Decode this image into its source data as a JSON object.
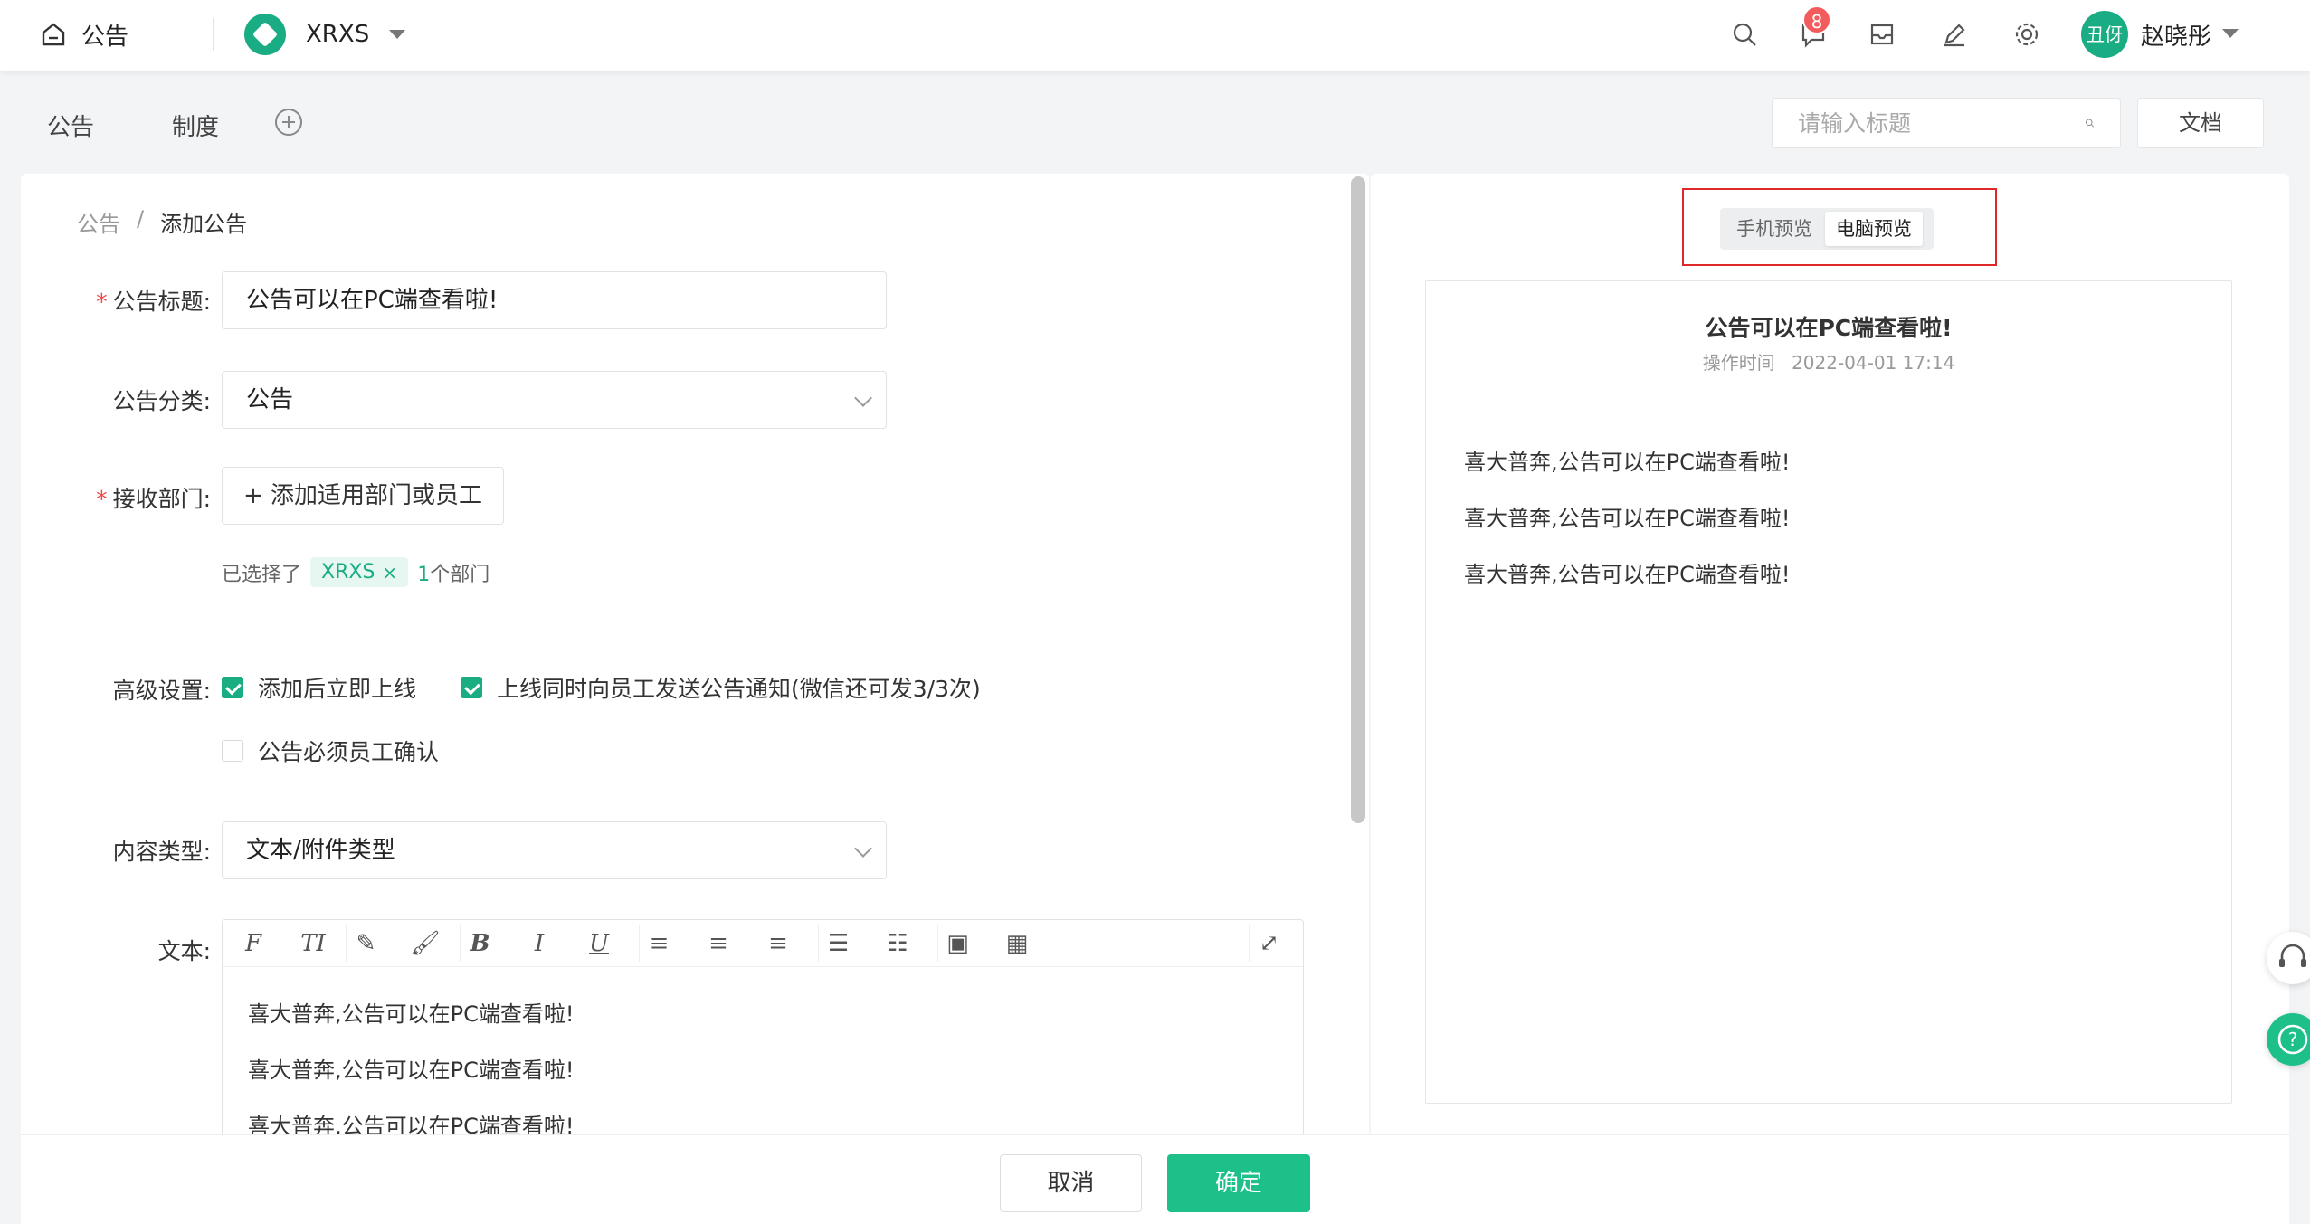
{
  "header": {
    "home_label": "公告",
    "org_name": "XRXS",
    "badge_count": "8",
    "avatar_text": "丑伢",
    "username": "赵晓彤"
  },
  "subnav": {
    "items": [
      "公告",
      "制度"
    ],
    "search_placeholder": "请输入标题",
    "doc_label": "文档"
  },
  "breadcrumb": {
    "root": "公告",
    "sep": "/",
    "current": "添加公告"
  },
  "form": {
    "title_label": "公告标题:",
    "title_value": "公告可以在PC端查看啦!",
    "category_label": "公告分类:",
    "category_value": "公告",
    "dept_label": "接收部门:",
    "dept_button": "+ 添加适用部门或员工",
    "selected_prefix": "已选择了",
    "selected_tag": "XRXS",
    "tag_remove": "×",
    "selected_count": "1",
    "selected_suffix": "个部门",
    "advanced_label": "高级设置:",
    "opt_online": "添加后立即上线",
    "opt_notify": "上线同时向员工发送公告通知(微信还可发3/3次)",
    "opt_confirm": "公告必须员工确认",
    "content_type_label": "内容类型:",
    "content_type_value": "文本/附件类型",
    "text_label": "文本:",
    "editor_lines": [
      "喜大普奔,公告可以在PC端查看啦!",
      "喜大普奔,公告可以在PC端查看啦!",
      "喜大普奔,公告可以在PC端查看啦!"
    ]
  },
  "footer": {
    "cancel": "取消",
    "ok": "确定"
  },
  "preview": {
    "tab_mobile": "手机预览",
    "tab_pc": "电脑预览",
    "title": "公告可以在PC端查看啦!",
    "time_label": "操作时间",
    "time_value": "2022-04-01 17:14",
    "paragraphs": [
      "喜大普奔,公告可以在PC端查看啦!",
      "喜大普奔,公告可以在PC端查看啦!",
      "喜大普奔,公告可以在PC端查看啦!"
    ]
  },
  "icons": [
    "home-icon",
    "org-logo-icon",
    "search-icon",
    "message-icon",
    "inbox-icon",
    "edit-icon",
    "settings-icon",
    "add-circle-icon",
    "headset-icon",
    "help-icon"
  ],
  "colors": {
    "accent": "#1ec08a",
    "badge": "#f25c5c",
    "highlight_border": "#e02828"
  }
}
